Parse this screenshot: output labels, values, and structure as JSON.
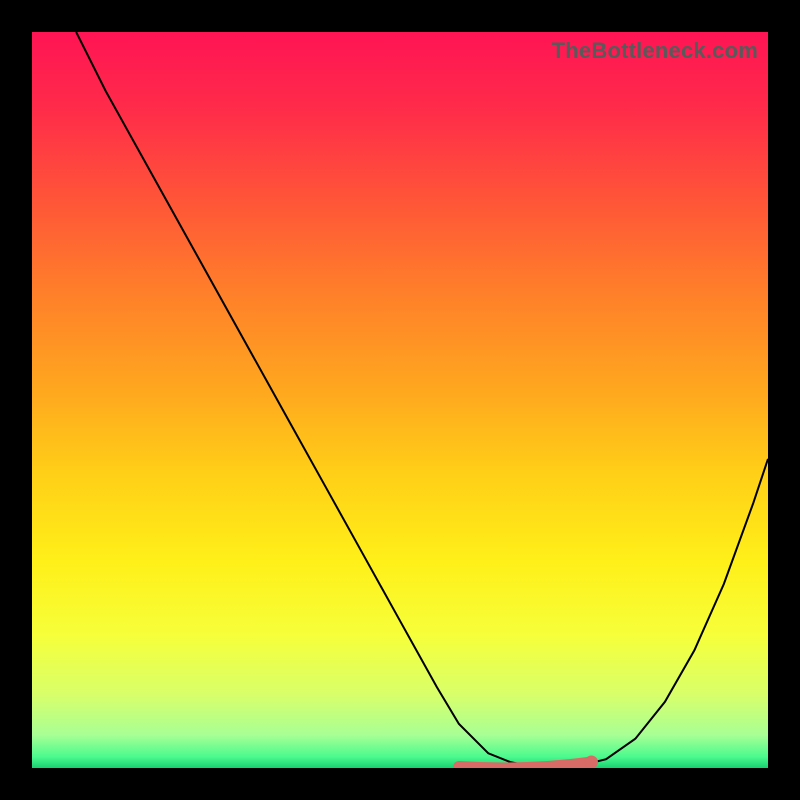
{
  "watermark": "TheBottleneck.com",
  "gradient_stops": [
    {
      "offset": 0.0,
      "color": "#ff1454"
    },
    {
      "offset": 0.1,
      "color": "#ff2a4a"
    },
    {
      "offset": 0.22,
      "color": "#ff5239"
    },
    {
      "offset": 0.35,
      "color": "#ff7e2a"
    },
    {
      "offset": 0.48,
      "color": "#ffa51f"
    },
    {
      "offset": 0.6,
      "color": "#ffcf17"
    },
    {
      "offset": 0.72,
      "color": "#fff019"
    },
    {
      "offset": 0.82,
      "color": "#f6ff3a"
    },
    {
      "offset": 0.9,
      "color": "#d8ff6a"
    },
    {
      "offset": 0.955,
      "color": "#a8ff94"
    },
    {
      "offset": 0.985,
      "color": "#4bfa8e"
    },
    {
      "offset": 1.0,
      "color": "#18d070"
    }
  ],
  "chart_data": {
    "type": "line",
    "title": "",
    "xlabel": "",
    "ylabel": "",
    "xlim": [
      0,
      100
    ],
    "ylim": [
      0,
      100
    ],
    "series": [
      {
        "name": "bottleneck-curve",
        "x": [
          6,
          10,
          15,
          20,
          25,
          30,
          35,
          40,
          45,
          50,
          55,
          58,
          62,
          65,
          68,
          71,
          74,
          78,
          82,
          86,
          90,
          94,
          98,
          100
        ],
        "y": [
          100,
          92,
          83,
          74,
          65,
          56,
          47,
          38,
          29,
          20,
          11,
          6,
          2,
          0.8,
          0.2,
          0.1,
          0.2,
          1.2,
          4,
          9,
          16,
          25,
          36,
          42
        ]
      }
    ],
    "highlight": {
      "name": "optimal-zone-marker",
      "color": "#d86b66",
      "x_start": 58,
      "x_end": 76,
      "y": 0.6
    }
  }
}
